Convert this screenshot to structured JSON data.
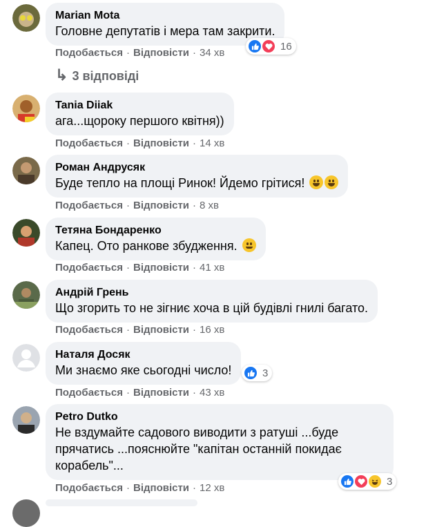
{
  "actions": {
    "like": "Подобається",
    "reply": "Відповісти",
    "dot": "·"
  },
  "view_replies": {
    "arrow": "↳",
    "label": "3 відповіді"
  },
  "colors": {
    "bubble": "#f0f2f5",
    "meta": "#65676b",
    "like_blue": "#1877f2",
    "love_red": "#f33e58",
    "haha_yellow": "#f7c52b"
  },
  "comments": [
    {
      "name": "Marian Mota",
      "text": "Головне депутатів і мера там закрити.",
      "time": "34 хв",
      "reactions": {
        "icons": [
          "like-icon",
          "love-icon"
        ],
        "count": "16"
      }
    },
    {
      "name": "Tania Diiak",
      "text": "ага...щороку першого квітня))",
      "time": "14 хв"
    },
    {
      "name": "Роман Андрусяк",
      "text": "Буде тепло на площі Ринок! Йдемо грітися!",
      "emoji": [
        "grinning-emoji",
        "grinning-emoji"
      ],
      "time": "8 хв"
    },
    {
      "name": "Тетяна Бондаренко",
      "text": "Капец. Ото ранкове збудження.",
      "emoji": [
        "slight-smile-emoji"
      ],
      "time": "41 хв"
    },
    {
      "name": "Андрій Грень",
      "text": "Що згорить то не зігниє хоча в цій будівлі гнилі багато.",
      "time": "16 хв"
    },
    {
      "name": "Наталя Досяк",
      "text": "Ми знаємо яке сьогодні число!",
      "time": "43 хв",
      "reactions": {
        "icons": [
          "like-icon"
        ],
        "count": "3"
      }
    },
    {
      "name": "Petro Dutko",
      "text": "Не вздумайте садового виводити з ратуші ...буде\nпрячатись ...пояснюйте \"капітан останній покидає\nкорабель\"...",
      "time": "12 хв",
      "reactions": {
        "icons": [
          "like-icon",
          "love-icon",
          "haha-icon"
        ],
        "count": "3"
      }
    }
  ]
}
